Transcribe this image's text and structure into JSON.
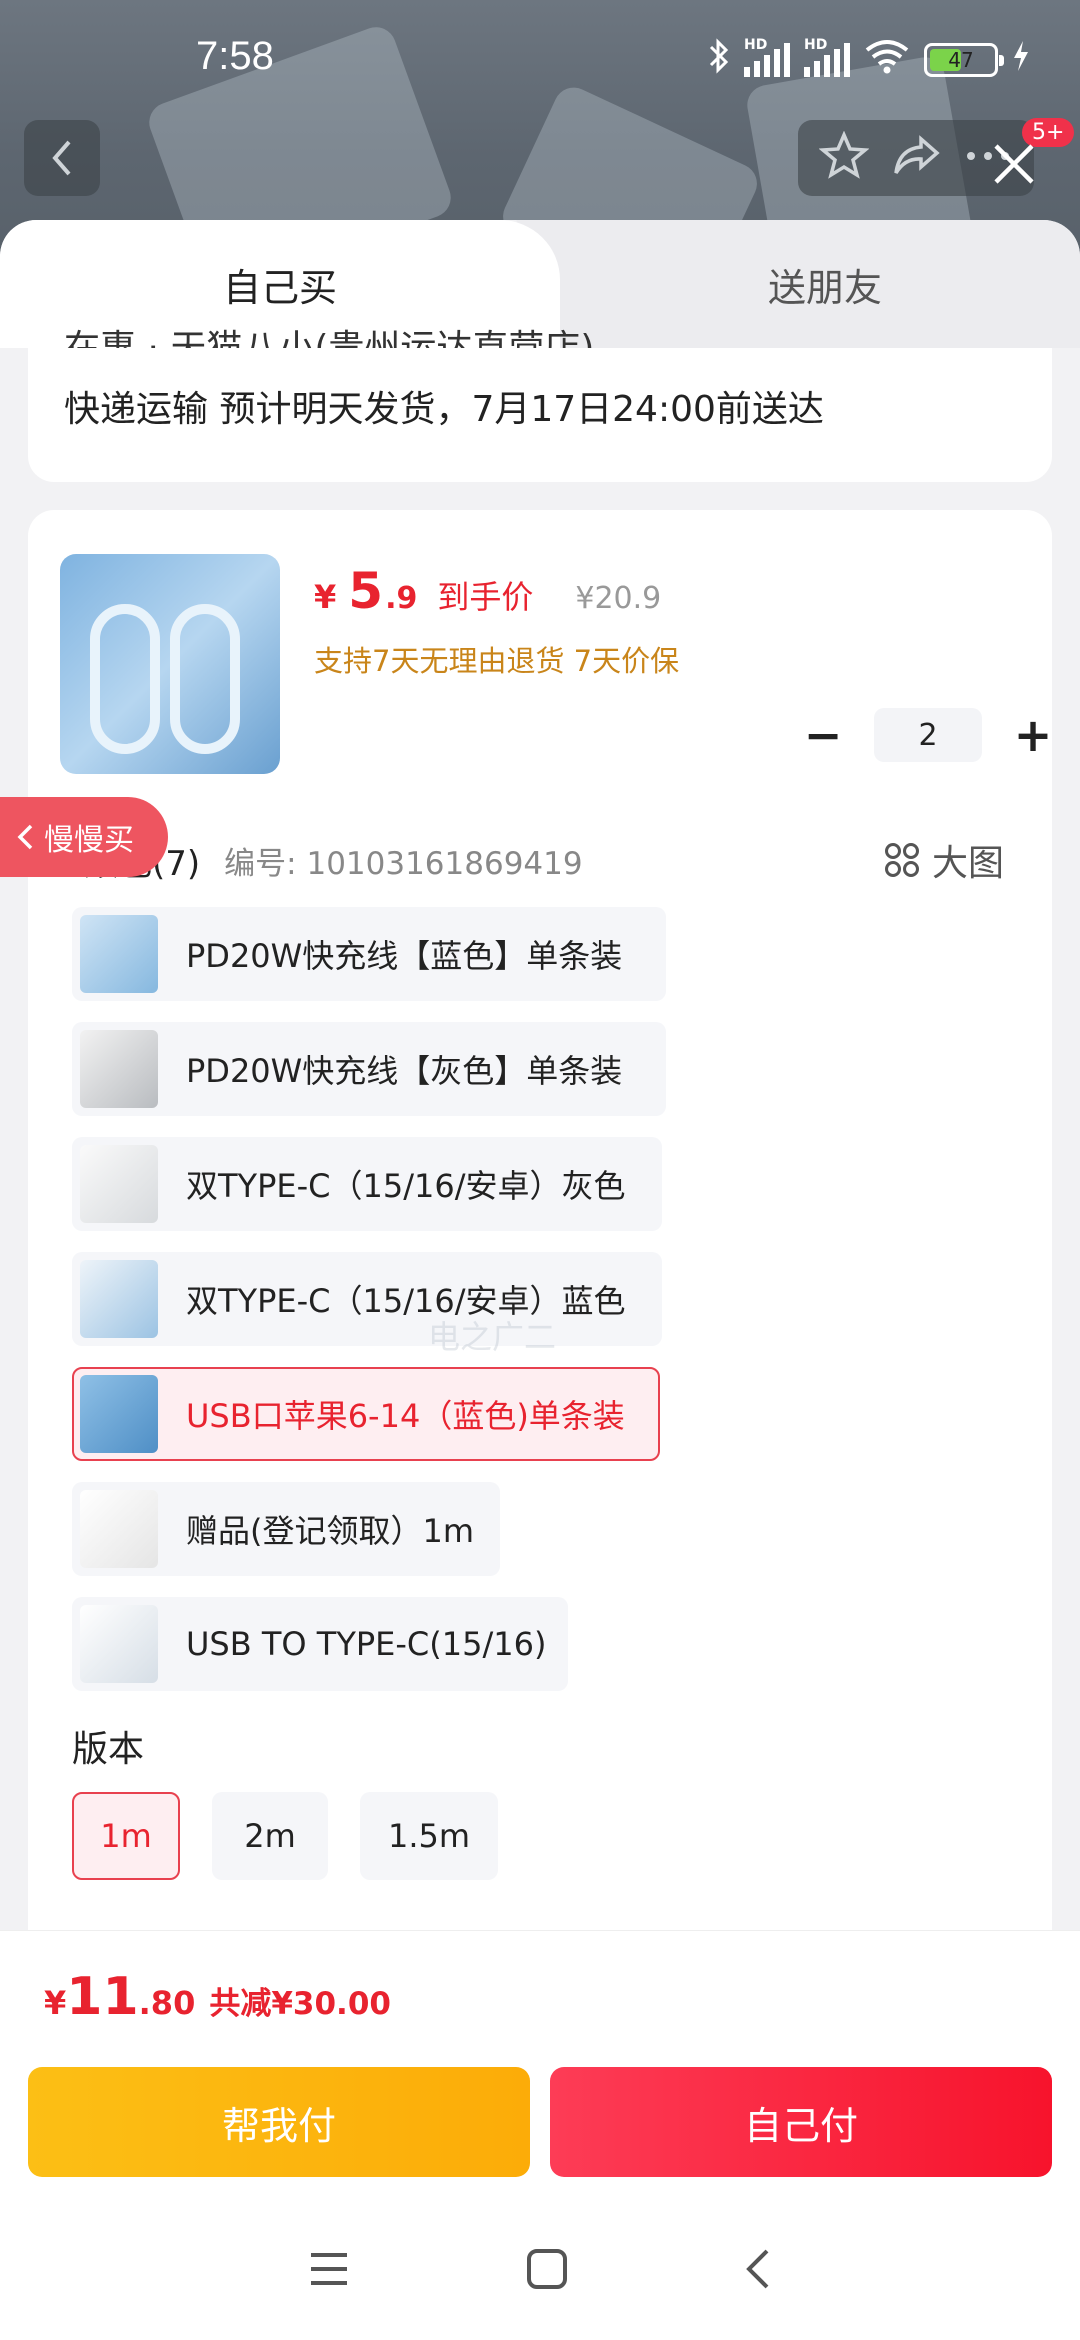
{
  "status_bar": {
    "time": "7:58",
    "signal1_label": "HD",
    "signal2_label": "HD",
    "battery_level": "47"
  },
  "top_nav": {
    "badge": "5+"
  },
  "tabs": {
    "buy_self": "自己买",
    "gift_friend": "送朋友"
  },
  "shipping": {
    "clipped_text": "在惠 · 天猫八小(贵州运达直营店)",
    "shipping_text": "快递运输 预计明天发货，7月17日24:00前送达"
  },
  "product": {
    "currency": "¥",
    "price_int": "5",
    "price_dec": ".9",
    "price_tag": "到手价",
    "original_price": "¥20.9",
    "guarantee": "支持7天无理由退货 7天价保",
    "quantity": "2",
    "minus": "−",
    "plus": "+"
  },
  "color_section": {
    "title": "颜色(7)",
    "sku_code": "编号: 10103161869419",
    "big_image_label": "大图"
  },
  "variants": [
    {
      "label": "PD20W快充线【蓝色】单条装",
      "selected": false
    },
    {
      "label": "PD20W快充线【灰色】单条装",
      "selected": false
    },
    {
      "label": "双TYPE-C（15/16/安卓）灰色",
      "selected": false
    },
    {
      "label": "双TYPE-C（15/16/安卓）蓝色",
      "selected": false
    },
    {
      "label": "USB口苹果6-14（蓝色)单条装",
      "selected": true
    },
    {
      "label": "赠品(登记领取）1m",
      "selected": false
    },
    {
      "label": "USB TO TYPE-C(15/16)",
      "selected": false
    }
  ],
  "version_section": {
    "title": "版本",
    "options": [
      {
        "label": "1m",
        "selected": true
      },
      {
        "label": "2m",
        "selected": false
      },
      {
        "label": "1.5m",
        "selected": false
      }
    ]
  },
  "slow_buy_pill": "慢慢买",
  "watermark": "电之广二",
  "footer": {
    "currency": "¥",
    "total_int": "11",
    "total_dec": ".80",
    "saving": "共减¥30.00",
    "help_pay": "帮我付",
    "self_pay": "自己付"
  },
  "colors": {
    "accent_red": "#e8232f",
    "gold": "#c9851a",
    "help_pay_yellow": "#fcbf15",
    "self_pay_red": "#f7132c"
  }
}
